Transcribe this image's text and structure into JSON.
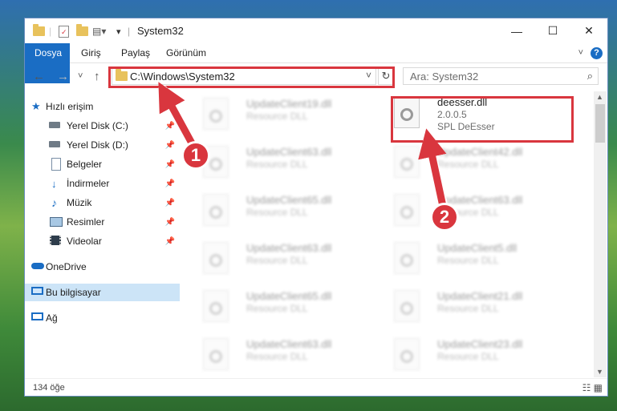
{
  "window": {
    "title": "System32",
    "minimize": "—",
    "maximize": "☐",
    "close": "✕"
  },
  "ribbon": {
    "tabs": [
      "Dosya",
      "Giriş",
      "Paylaş",
      "Görünüm"
    ],
    "help": "?"
  },
  "nav": {
    "back": "←",
    "forward": "→",
    "recent": "˅",
    "up": "↑",
    "address": "C:\\Windows\\System32",
    "address_dropdown": "˅",
    "refresh": "↻",
    "search_placeholder": "Ara: System32",
    "search_icon": "⌕"
  },
  "sidebar": {
    "items": [
      {
        "label": "Hızlı erişim",
        "icon": "star-icon",
        "pinned": false
      },
      {
        "label": "Yerel Disk (C:)",
        "icon": "drive-icon",
        "pinned": true
      },
      {
        "label": "Yerel Disk (D:)",
        "icon": "drive-icon",
        "pinned": true
      },
      {
        "label": "Belgeler",
        "icon": "document-icon",
        "pinned": true
      },
      {
        "label": "İndirmeler",
        "icon": "download-icon",
        "pinned": true
      },
      {
        "label": "Müzik",
        "icon": "music-icon",
        "pinned": true
      },
      {
        "label": "Resimler",
        "icon": "pictures-icon",
        "pinned": true
      },
      {
        "label": "Videolar",
        "icon": "video-icon",
        "pinned": true
      },
      {
        "label": "OneDrive",
        "icon": "cloud-icon",
        "pinned": false
      },
      {
        "label": "Bu bilgisayar",
        "icon": "computer-icon",
        "pinned": false
      },
      {
        "label": "Ağ",
        "icon": "network-icon",
        "pinned": false
      }
    ],
    "pin_glyph": "📌"
  },
  "files": {
    "left": [
      {
        "name": "UpdateClient19.dll",
        "desc": "Resource DLL"
      },
      {
        "name": "UpdateClient63.dll",
        "desc": "Resource DLL"
      },
      {
        "name": "UpdateClient65.dll",
        "desc": "Resource DLL"
      },
      {
        "name": "UpdateClient63.dll",
        "desc": "Resource DLL"
      },
      {
        "name": "UpdateClient65.dll",
        "desc": "Resource DLL"
      },
      {
        "name": "UpdateClient63.dll",
        "desc": "Resource DLL"
      }
    ],
    "right": [
      {
        "name": "UpdateClient42.dll",
        "desc": "Resource DLL"
      },
      {
        "name": "UpdateClient63.dll",
        "desc": "Resource DLL"
      },
      {
        "name": "UpdateClient5.dll",
        "desc": "Resource DLL"
      },
      {
        "name": "UpdateClient21.dll",
        "desc": "Resource DLL"
      },
      {
        "name": "UpdateClient23.dll",
        "desc": "Resource DLL"
      }
    ],
    "highlighted": {
      "name": "deesser.dll",
      "version": "2.0.0.5",
      "desc": "SPL DeEsser"
    }
  },
  "status": {
    "count": "134 öğe",
    "view_icons": "☷ ▦"
  },
  "annotations": {
    "badge1": "1",
    "badge2": "2",
    "color": "#d9363e"
  }
}
